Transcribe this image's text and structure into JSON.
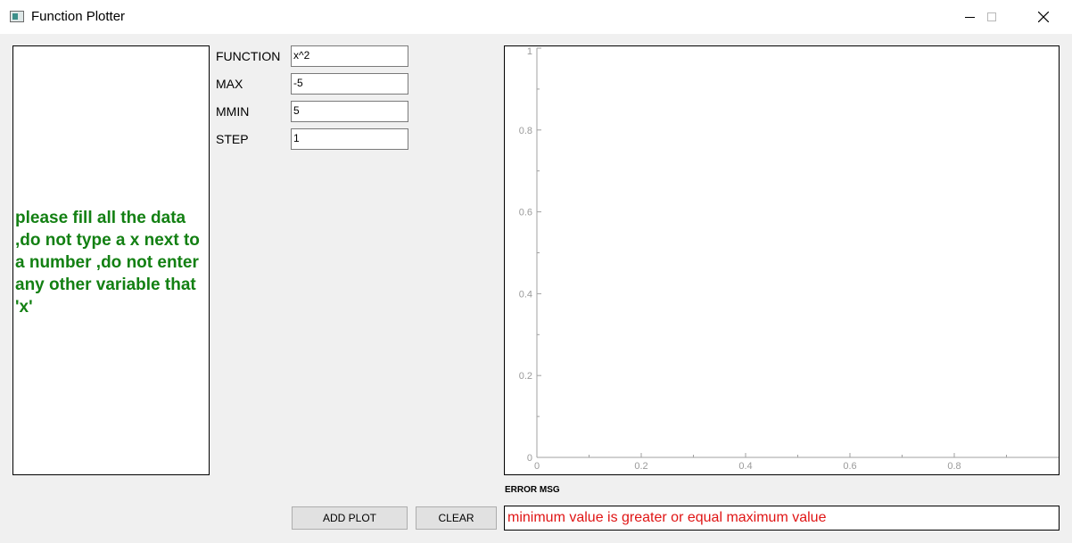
{
  "window": {
    "title": "Function Plotter"
  },
  "info": {
    "text": "please fill all the data ,do not type a x next to a number ,do not enter any other variable that 'x'"
  },
  "form": {
    "function_label": "FUNCTION",
    "function_value": "x^2",
    "max_label": "MAX",
    "max_value": "-5",
    "min_label": "MMIN",
    "min_value": "5",
    "step_label": "STEP",
    "step_value": "1"
  },
  "plot": {
    "y_ticks": [
      "0",
      "0.2",
      "0.4",
      "0.6",
      "0.8",
      "1"
    ],
    "x_ticks": [
      "0",
      "0.2",
      "0.4",
      "0.6",
      "0.8"
    ],
    "xlim": [
      0,
      1
    ],
    "ylim": [
      0,
      1
    ],
    "grid": false
  },
  "error": {
    "label": "ERROR MSG",
    "message": "minimum value is greater or equal maximum value",
    "color": "#e01515"
  },
  "buttons": {
    "add_plot": "ADD PLOT",
    "clear": "CLEAR"
  },
  "colors": {
    "info_text": "#138013",
    "background": "#f0f0f0"
  },
  "icons": {
    "app": "app-icon",
    "minimize": "minimize-icon",
    "maximize": "maximize-icon",
    "close": "close-icon"
  }
}
